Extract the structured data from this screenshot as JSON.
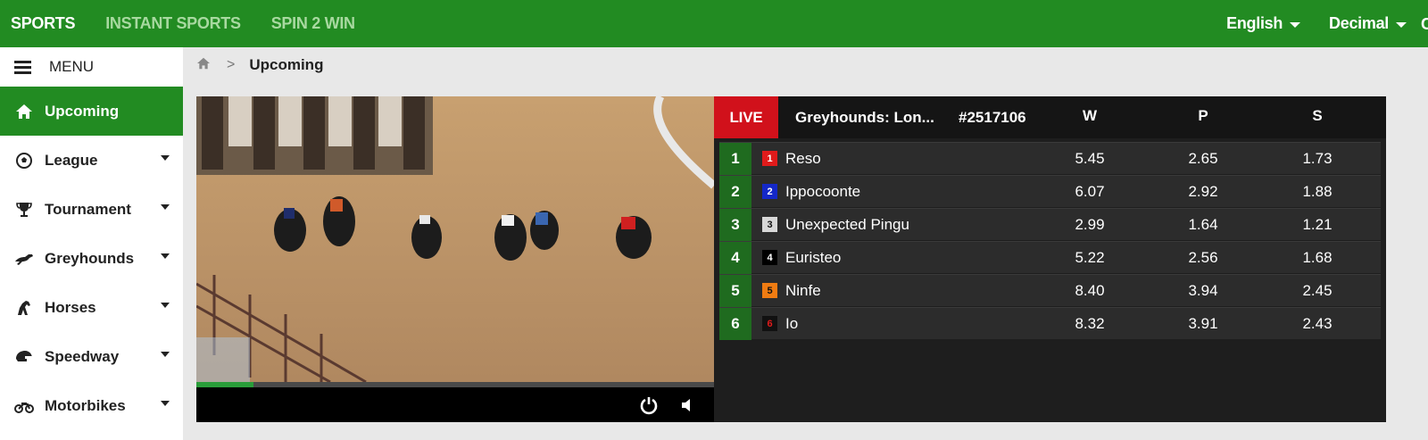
{
  "topnav": {
    "items": [
      {
        "label": "SPORTS",
        "active": true
      },
      {
        "label": "INSTANT SPORTS",
        "active": false
      },
      {
        "label": "SPIN 2 WIN",
        "active": false
      }
    ],
    "language": "English",
    "odds_format": "Decimal",
    "edge_fragment": "C"
  },
  "sidebar": {
    "menu_label": "MENU",
    "items": [
      {
        "label": "Upcoming",
        "icon": "home-icon",
        "active": true
      },
      {
        "label": "League",
        "icon": "soccer-ball-icon"
      },
      {
        "label": "Tournament",
        "icon": "trophy-icon"
      },
      {
        "label": "Greyhounds",
        "icon": "greyhound-icon"
      },
      {
        "label": "Horses",
        "icon": "horse-icon"
      },
      {
        "label": "Speedway",
        "icon": "helmet-icon"
      },
      {
        "label": "Motorbikes",
        "icon": "motorbike-icon"
      }
    ]
  },
  "breadcrumb": {
    "home_icon": "home-icon",
    "separator": ">",
    "current": "Upcoming"
  },
  "video": {
    "progress": 0.11,
    "controls": [
      "power-icon",
      "volume-icon"
    ]
  },
  "race": {
    "live_label": "LIVE",
    "name": "Greyhounds: Lon...",
    "id": "#2517106",
    "columns": [
      "W",
      "P",
      "S"
    ],
    "runners": [
      {
        "num": "1",
        "trap": "1",
        "name": "Reso",
        "w": "5.45",
        "p": "2.65",
        "s": "1.73",
        "trap_bg": "#e01b1b",
        "trap_fg": "#ffffff"
      },
      {
        "num": "2",
        "trap": "2",
        "name": "Ippocoonte",
        "w": "6.07",
        "p": "2.92",
        "s": "1.88",
        "trap_bg": "#1428c8",
        "trap_fg": "#ffffff"
      },
      {
        "num": "3",
        "trap": "3",
        "name": "Unexpected Pingu",
        "w": "2.99",
        "p": "1.64",
        "s": "1.21",
        "trap_bg": "#d8d8d8",
        "trap_fg": "#111111"
      },
      {
        "num": "4",
        "trap": "4",
        "name": "Euristeo",
        "w": "5.22",
        "p": "2.56",
        "s": "1.68",
        "trap_bg": "#000000",
        "trap_fg": "#ffffff"
      },
      {
        "num": "5",
        "trap": "5",
        "name": "Ninfe",
        "w": "8.40",
        "p": "3.94",
        "s": "2.45",
        "trap_bg": "#f07c12",
        "trap_fg": "#111111"
      },
      {
        "num": "6",
        "trap": "6",
        "name": "Io",
        "w": "8.32",
        "p": "3.91",
        "s": "2.43",
        "trap_bg": "#111111",
        "trap_fg": "#e01b1b"
      }
    ]
  }
}
